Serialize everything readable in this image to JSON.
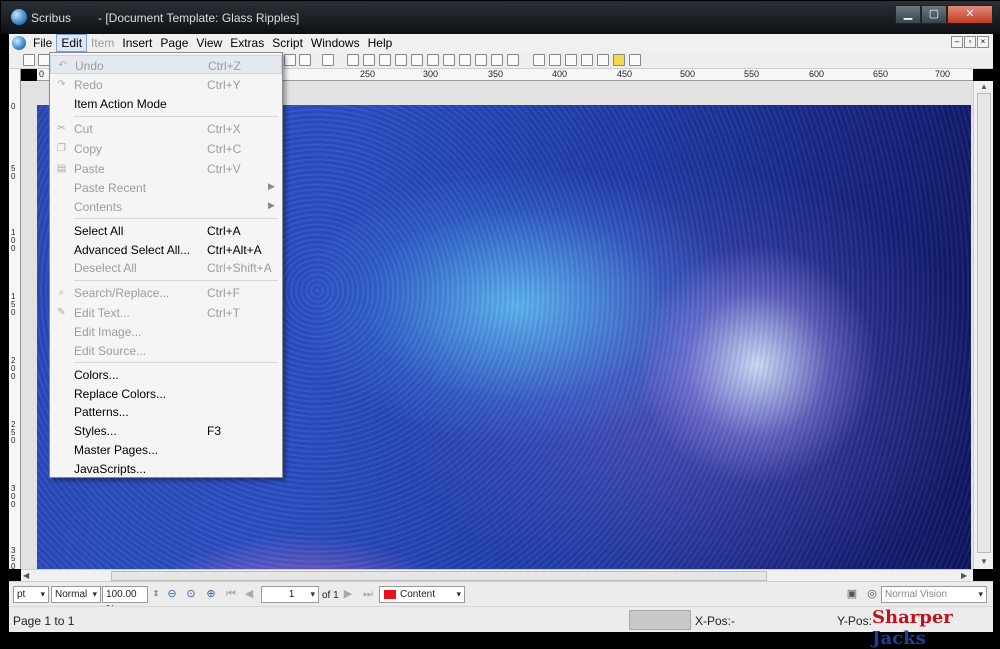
{
  "window": {
    "app_name": "Scribus",
    "document_title": "- [Document Template: Glass Ripples]",
    "min_label": "▁",
    "max_label": "▢",
    "close_label": "✕"
  },
  "menubar": {
    "items": [
      {
        "label": "File"
      },
      {
        "label": "Edit"
      },
      {
        "label": "Item"
      },
      {
        "label": "Insert"
      },
      {
        "label": "Page"
      },
      {
        "label": "View"
      },
      {
        "label": "Extras"
      },
      {
        "label": "Script"
      },
      {
        "label": "Windows"
      },
      {
        "label": "Help"
      }
    ],
    "mdi": [
      "–",
      "▫",
      "×"
    ]
  },
  "ruler": {
    "h_labels": [
      "0",
      "250",
      "300",
      "350",
      "400",
      "450",
      "500",
      "550",
      "600",
      "650",
      "700"
    ],
    "v_labels": [
      "0",
      "50",
      "100",
      "150",
      "200",
      "250",
      "300",
      "350"
    ]
  },
  "edit_menu": {
    "undo": {
      "label": "Undo",
      "shortcut": "Ctrl+Z"
    },
    "redo": {
      "label": "Redo",
      "shortcut": "Ctrl+Y"
    },
    "item_action_mode": {
      "label": "Item Action Mode"
    },
    "cut": {
      "label": "Cut",
      "shortcut": "Ctrl+X"
    },
    "copy": {
      "label": "Copy",
      "shortcut": "Ctrl+C"
    },
    "paste": {
      "label": "Paste",
      "shortcut": "Ctrl+V"
    },
    "paste_recent": {
      "label": "Paste Recent"
    },
    "contents": {
      "label": "Contents"
    },
    "select_all": {
      "label": "Select All",
      "shortcut": "Ctrl+A"
    },
    "advanced_select_all": {
      "label": "Advanced Select All...",
      "shortcut": "Ctrl+Alt+A"
    },
    "deselect_all": {
      "label": "Deselect All",
      "shortcut": "Ctrl+Shift+A"
    },
    "search_replace": {
      "label": "Search/Replace...",
      "shortcut": "Ctrl+F"
    },
    "edit_text": {
      "label": "Edit Text...",
      "shortcut": "Ctrl+T"
    },
    "edit_image": {
      "label": "Edit Image..."
    },
    "edit_source": {
      "label": "Edit Source..."
    },
    "colors": {
      "label": "Colors..."
    },
    "replace_colors": {
      "label": "Replace Colors..."
    },
    "patterns": {
      "label": "Patterns..."
    },
    "styles": {
      "label": "Styles...",
      "shortcut": "F3"
    },
    "master_pages": {
      "label": "Master Pages..."
    },
    "javascripts": {
      "label": "JavaScripts..."
    }
  },
  "statusbar": {
    "unit": "pt",
    "quality": "Normal",
    "zoom": "100.00 %",
    "page_number": "1",
    "page_of": "of 1",
    "layer": "Content",
    "layer_color": "#e8141c",
    "vision": "Normal Vision",
    "page_range": "Page 1 to 1",
    "xpos_label": "X-Pos:",
    "xpos_value": "-",
    "ypos_label": "Y-Pos:"
  },
  "watermark": {
    "part1": "Sharper",
    "part2": "Jacks"
  }
}
